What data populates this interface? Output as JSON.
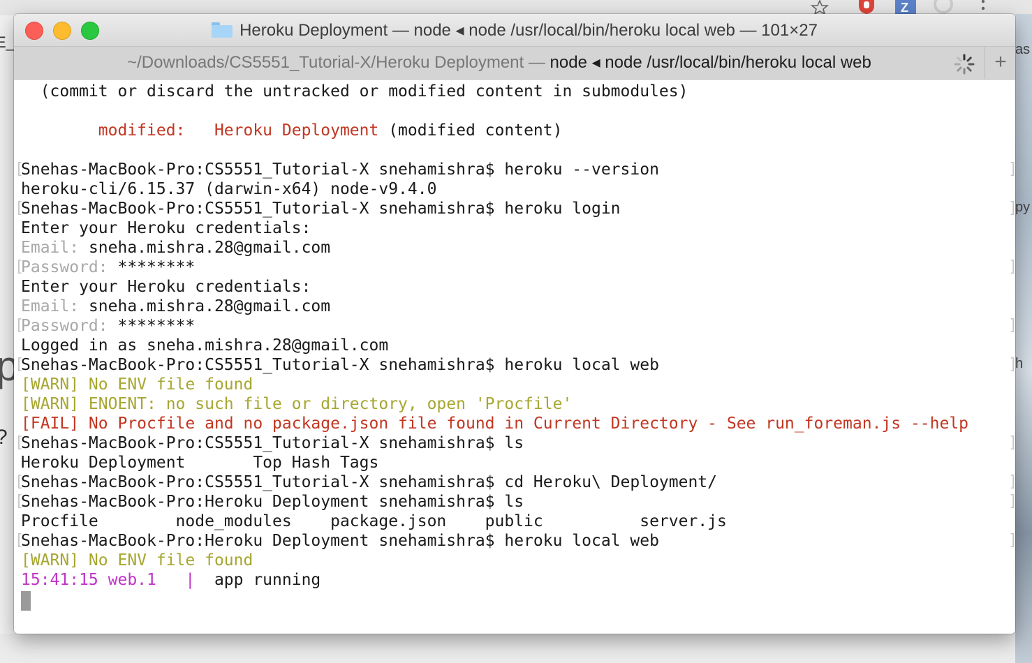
{
  "background": {
    "left_fragments": [
      "E_",
      "p",
      "?"
    ],
    "right_fragments": [
      "as",
      "py",
      "h"
    ]
  },
  "window": {
    "title": "Heroku Deployment — node ◂ node /usr/local/bin/heroku local web — 101×27",
    "tab": {
      "path": "~/Downloads/CS5551_Tutorial-X/Heroku Deployment — ",
      "process": "node ◂ node /usr/local/bin/heroku local web"
    },
    "new_tab_label": "+"
  },
  "terminal": {
    "lines": [
      {
        "segments": [
          {
            "text": "  (commit or discard the untracked or modified content in submodules)",
            "color": "default"
          }
        ]
      },
      {
        "segments": []
      },
      {
        "segments": [
          {
            "text": "        modified:   Heroku Deployment",
            "color": "red"
          },
          {
            "text": " (modified content)",
            "color": "default"
          }
        ]
      },
      {
        "segments": []
      },
      {
        "mark": true,
        "segments": [
          {
            "text": "Snehas-MacBook-Pro:CS5551_Tutorial-X snehamishra$ heroku --version",
            "color": "default"
          }
        ]
      },
      {
        "segments": [
          {
            "text": "heroku-cli/6.15.37 (darwin-x64) node-v9.4.0",
            "color": "default"
          }
        ]
      },
      {
        "mark": true,
        "segments": [
          {
            "text": "Snehas-MacBook-Pro:CS5551_Tutorial-X snehamishra$ heroku login",
            "color": "default"
          }
        ]
      },
      {
        "segments": [
          {
            "text": "Enter your Heroku credentials:",
            "color": "default"
          }
        ]
      },
      {
        "segments": [
          {
            "text": "Email: ",
            "color": "gray"
          },
          {
            "text": "sneha.mishra.28@gmail.com",
            "color": "default"
          }
        ]
      },
      {
        "mark": true,
        "segments": [
          {
            "text": "Password: ",
            "color": "gray"
          },
          {
            "text": "********",
            "color": "default"
          }
        ]
      },
      {
        "segments": [
          {
            "text": "Enter your Heroku credentials:",
            "color": "default"
          }
        ]
      },
      {
        "segments": [
          {
            "text": "Email: ",
            "color": "gray"
          },
          {
            "text": "sneha.mishra.28@gmail.com",
            "color": "default"
          }
        ]
      },
      {
        "mark": true,
        "segments": [
          {
            "text": "Password: ",
            "color": "gray"
          },
          {
            "text": "********",
            "color": "default"
          }
        ]
      },
      {
        "segments": [
          {
            "text": "Logged in as sneha.mishra.28@gmail.com",
            "color": "default"
          }
        ]
      },
      {
        "mark": true,
        "segments": [
          {
            "text": "Snehas-MacBook-Pro:CS5551_Tutorial-X snehamishra$ heroku local web",
            "color": "default"
          }
        ]
      },
      {
        "segments": [
          {
            "text": "[WARN] No ENV file found",
            "color": "yellow"
          }
        ]
      },
      {
        "segments": [
          {
            "text": "[WARN] ENOENT: no such file or directory, open 'Procfile'",
            "color": "yellow"
          }
        ]
      },
      {
        "segments": [
          {
            "text": "[FAIL] No Procfile and no package.json file found in Current Directory - See run_foreman.js --help",
            "color": "red"
          }
        ]
      },
      {
        "mark": true,
        "segments": [
          {
            "text": "Snehas-MacBook-Pro:CS5551_Tutorial-X snehamishra$ ls",
            "color": "default"
          }
        ]
      },
      {
        "segments": [
          {
            "text": "Heroku Deployment       Top Hash Tags",
            "color": "default"
          }
        ]
      },
      {
        "mark": true,
        "segments": [
          {
            "text": "Snehas-MacBook-Pro:CS5551_Tutorial-X snehamishra$ cd Heroku\\ Deployment/",
            "color": "default"
          }
        ]
      },
      {
        "mark": true,
        "segments": [
          {
            "text": "Snehas-MacBook-Pro:Heroku Deployment snehamishra$ ls",
            "color": "default"
          }
        ]
      },
      {
        "segments": [
          {
            "text": "Procfile        node_modules    package.json    public          server.js",
            "color": "default"
          }
        ]
      },
      {
        "mark": true,
        "segments": [
          {
            "text": "Snehas-MacBook-Pro:Heroku Deployment snehamishra$ heroku local web",
            "color": "default"
          }
        ]
      },
      {
        "segments": [
          {
            "text": "[WARN] No ENV file found",
            "color": "yellow"
          }
        ]
      },
      {
        "segments": [
          {
            "text": "15:41:15 web.1   |",
            "color": "magenta"
          },
          {
            "text": "  app running",
            "color": "default"
          }
        ]
      }
    ]
  }
}
